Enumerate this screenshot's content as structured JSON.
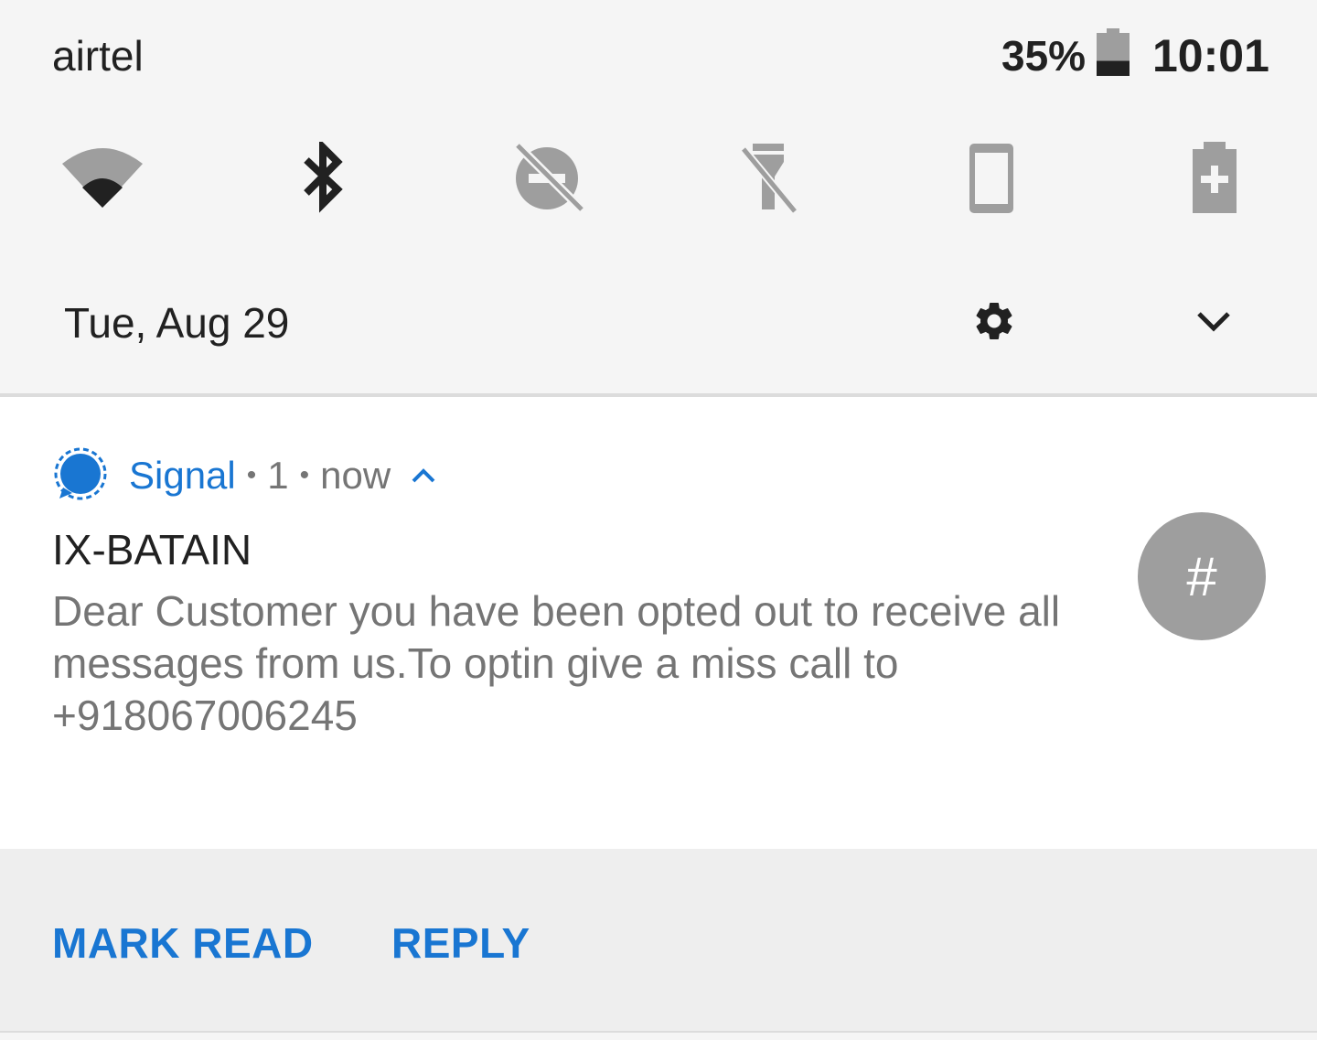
{
  "status_bar": {
    "carrier": "airtel",
    "battery_percent": "35%",
    "battery_level": 0.35,
    "time": "10:01"
  },
  "quick_settings": {
    "tiles": [
      {
        "icon": "wifi-icon",
        "state": "on"
      },
      {
        "icon": "bluetooth-icon",
        "state": "on"
      },
      {
        "icon": "do-not-disturb-off-icon",
        "state": "off"
      },
      {
        "icon": "flashlight-off-icon",
        "state": "off"
      },
      {
        "icon": "auto-rotate-icon",
        "state": "off"
      },
      {
        "icon": "battery-saver-icon",
        "state": "off"
      }
    ]
  },
  "header": {
    "date": "Tue, Aug 29"
  },
  "notification": {
    "app_name": "Signal",
    "count": "1",
    "time": "now",
    "title": "IX-BATAIN",
    "body": "Dear Customer you have been opted out to receive all messages from us.To optin give a miss call to +918067006245",
    "avatar_text": "#",
    "separator": "•"
  },
  "actions": {
    "mark_read": "MARK READ",
    "reply": "REPLY"
  },
  "colors": {
    "accent": "#1976d2",
    "panel_bg": "#f5f5f5",
    "icon_active": "#212121",
    "icon_inactive": "#9e9e9e"
  }
}
